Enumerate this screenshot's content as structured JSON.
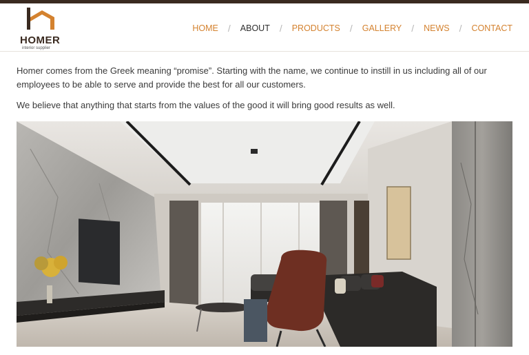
{
  "brand": {
    "name": "HOMER",
    "tagline": "interior supplier",
    "colors": {
      "primary": "#3a2a20",
      "accent": "#d4822f"
    }
  },
  "nav": {
    "items": [
      {
        "label": "HOME",
        "active": false
      },
      {
        "label": "ABOUT",
        "active": true
      },
      {
        "label": "PRODUCTS",
        "active": false
      },
      {
        "label": "GALLERY",
        "active": false
      },
      {
        "label": "NEWS",
        "active": false
      },
      {
        "label": "CONTACT",
        "active": false
      }
    ]
  },
  "about": {
    "paragraph_1": "Homer comes from the Greek meaning “promise”. Starting with the name, we continue to instill in us including all of our employees to be able to serve and provide the best for all our customers.",
    "paragraph_2": "We believe that anything that starts from the values of the good it will bring good results as well."
  }
}
